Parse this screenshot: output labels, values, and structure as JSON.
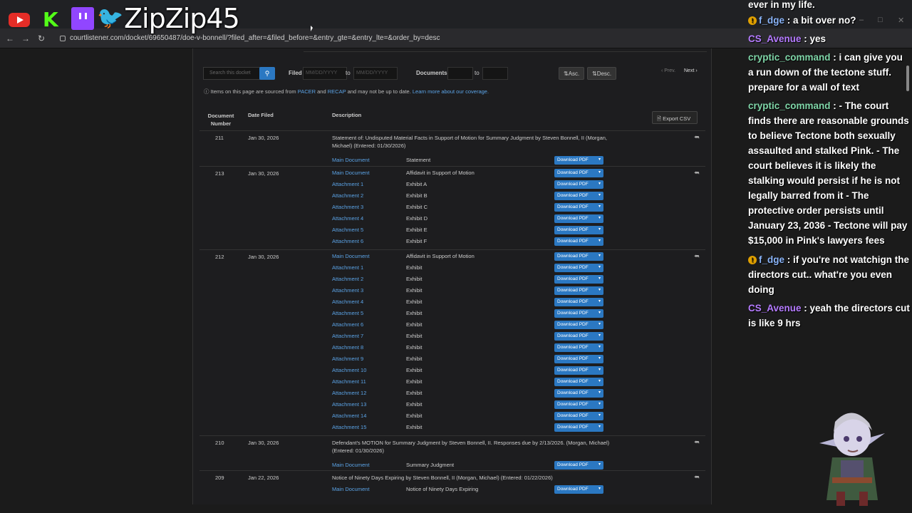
{
  "overlay": {
    "streamer_name": "ZipZip45"
  },
  "browser": {
    "url": "courtlistener.com/docket/69650487/doe-v-bonnell/?filed_after=&filed_before=&entry_gte=&entry_lte=&order_by=desc"
  },
  "toolbar": {
    "search_placeholder": "Search this docket",
    "filed_label": "Filed",
    "date_placeholder": "MM/DD/YYYY",
    "to_label": "to",
    "documents_label": "Documents",
    "asc_label": "Asc.",
    "desc_label": "Desc.",
    "prev_label": "‹ Prev.",
    "next_label": "Next ›"
  },
  "notice": {
    "prefix": "Items on this page are sourced from",
    "pacer": "PACER",
    "and": "and",
    "recap": "RECAP",
    "suffix": "and may not be up to date.",
    "learn_more": "Learn more about our coverage."
  },
  "table": {
    "headers": {
      "doc_number": "Document Number",
      "date_filed": "Date Filed",
      "description": "Description"
    },
    "export_label": "Export CSV",
    "download_label": "Download PDF",
    "entries": [
      {
        "number": "211",
        "date": "Jan 30, 2026",
        "description": "Statement of: Undisputed Material Facts in Support of Motion for Summary Judgment by Steven Bonnell, II (Morgan, Michael) (Entered: 01/30/2026)",
        "docs": [
          {
            "link": "Main Document",
            "desc": "Statement"
          }
        ]
      },
      {
        "number": "213",
        "date": "Jan 30, 2026",
        "description": "",
        "docs": [
          {
            "link": "Main Document",
            "desc": "Affidavit in Support of Motion"
          },
          {
            "link": "Attachment 1",
            "desc": "Exhibit A"
          },
          {
            "link": "Attachment 2",
            "desc": "Exhibit B"
          },
          {
            "link": "Attachment 3",
            "desc": "Exhibit C"
          },
          {
            "link": "Attachment 4",
            "desc": "Exhibit D"
          },
          {
            "link": "Attachment 5",
            "desc": "Exhibit E"
          },
          {
            "link": "Attachment 6",
            "desc": "Exhibit F"
          }
        ]
      },
      {
        "number": "212",
        "date": "Jan 30, 2026",
        "description": "",
        "docs": [
          {
            "link": "Main Document",
            "desc": "Affidavit in Support of Motion"
          },
          {
            "link": "Attachment 1",
            "desc": "Exhibit"
          },
          {
            "link": "Attachment 2",
            "desc": "Exhibit"
          },
          {
            "link": "Attachment 3",
            "desc": "Exhibit"
          },
          {
            "link": "Attachment 4",
            "desc": "Exhibit"
          },
          {
            "link": "Attachment 5",
            "desc": "Exhibit"
          },
          {
            "link": "Attachment 6",
            "desc": "Exhibit"
          },
          {
            "link": "Attachment 7",
            "desc": "Exhibit"
          },
          {
            "link": "Attachment 8",
            "desc": "Exhibit"
          },
          {
            "link": "Attachment 9",
            "desc": "Exhibit"
          },
          {
            "link": "Attachment 10",
            "desc": "Exhibit"
          },
          {
            "link": "Attachment 11",
            "desc": "Exhibit"
          },
          {
            "link": "Attachment 12",
            "desc": "Exhibit"
          },
          {
            "link": "Attachment 13",
            "desc": "Exhibit"
          },
          {
            "link": "Attachment 14",
            "desc": "Exhibit"
          },
          {
            "link": "Attachment 15",
            "desc": "Exhibit"
          }
        ]
      },
      {
        "number": "210",
        "date": "Jan 30, 2026",
        "description": "Defendant's MOTION for Summary Judgment by Steven Bonnell, II. Responses due by 2/13/2026. (Morgan, Michael) (Entered: 01/30/2026)",
        "docs": [
          {
            "link": "Main Document",
            "desc": "Summary Judgment"
          }
        ]
      },
      {
        "number": "209",
        "date": "Jan 22, 2026",
        "description": "Notice of Ninety Days Expiring by Steven Bonnell, II (Morgan, Michael) (Entered: 01/22/2026)",
        "docs": [
          {
            "link": "Main Document",
            "desc": "Notice of Ninety Days Expiring"
          }
        ]
      }
    ]
  },
  "chat": [
    {
      "user": "",
      "badge": false,
      "text": "ever in my life.",
      "color": "#ffffff"
    },
    {
      "user": "f_dge",
      "badge": true,
      "text": "a bit over no?",
      "color": "#8ab4f8"
    },
    {
      "user": "CS_Avenue",
      "badge": false,
      "text": "yes",
      "color": "#b57bff"
    },
    {
      "user": "cryptic_command",
      "badge": false,
      "text": "i can give you a run down of the tectone stuff. prepare for a wall of text",
      "color": "#7fd6a8"
    },
    {
      "user": "cryptic_command",
      "badge": false,
      "text": "- The court finds there are reasonable grounds to believe Tectone both sexually assaulted and stalked Pink. - The court believes it is likely the stalking would persist if he is not legally barred from it - The protective order persists until January 23, 2036 - Tectone will pay $15,000 in Pink's lawyers fees",
      "color": "#7fd6a8"
    },
    {
      "user": "f_dge",
      "badge": true,
      "text": "if you're not watchign the directors cut.. what're you even doing",
      "color": "#8ab4f8"
    },
    {
      "user": "CS_Avenue",
      "badge": false,
      "text": "yeah the directors cut is like 9 hrs",
      "color": "#b57bff"
    }
  ]
}
